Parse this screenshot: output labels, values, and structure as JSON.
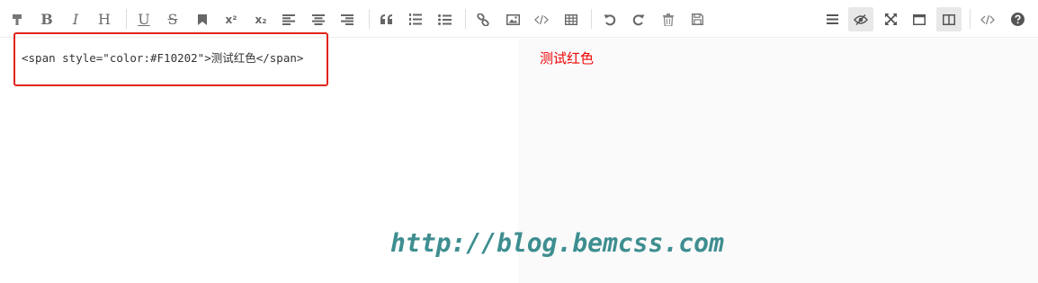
{
  "toolbar": {
    "bold": "B",
    "italic": "I",
    "heading": "H",
    "underline": "U",
    "strike": "S",
    "superscript": "x²",
    "subscript": "x₂"
  },
  "editor": {
    "code": "<span style=\"color:#F10202\">测试红色</span>"
  },
  "preview": {
    "text": "测试红色",
    "text_color": "#F10202"
  },
  "watermark": {
    "text": "http://blog.bemcss.com"
  },
  "colors": {
    "highlight_border": "#e2231a",
    "watermark": "#3e8e90"
  }
}
